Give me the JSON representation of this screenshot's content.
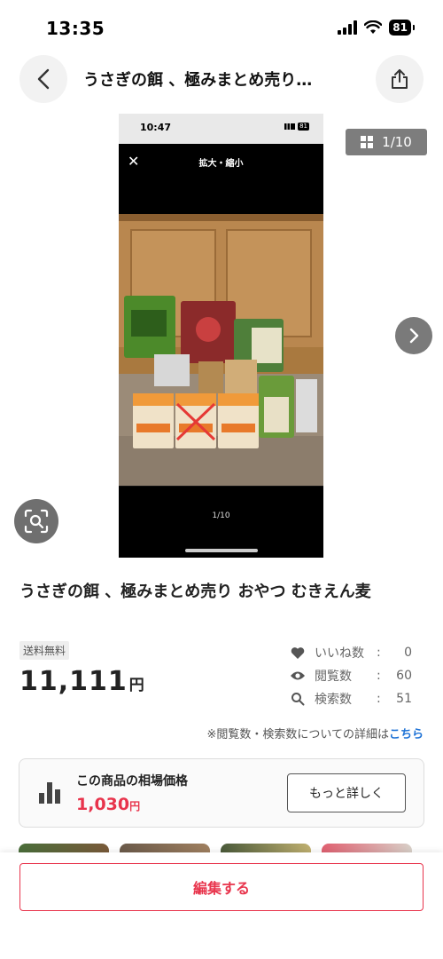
{
  "status_bar": {
    "time": "13:35",
    "battery": "81"
  },
  "nav": {
    "title": "うさぎの餌 、極みまとめ売り…"
  },
  "photo": {
    "inner_time": "10:47",
    "inner_battery": "81",
    "inner_title": "拡大・縮小",
    "inner_counter": "1/10"
  },
  "counter": {
    "label": "1/10"
  },
  "product": {
    "title": "うさぎの餌 、極みまとめ売り おやつ むきえん麦",
    "shipping": "送料無料",
    "price": "11,111",
    "currency": "円"
  },
  "stats": [
    {
      "icon": "heart-icon",
      "label": "いいね数",
      "colon": ":",
      "value": "0"
    },
    {
      "icon": "eye-icon",
      "label": "閲覧数",
      "colon": ":",
      "value": "60"
    },
    {
      "icon": "search-icon",
      "label": "検索数",
      "colon": ":",
      "value": "51"
    }
  ],
  "note": {
    "text": "※閲覧数・検索数についての詳細は",
    "link": "こちら"
  },
  "market": {
    "label": "この商品の相場価格",
    "price": "1,030",
    "currency": "円",
    "button": "もっと詳しく"
  },
  "bottom": {
    "edit_button": "編集する"
  },
  "colors": {
    "accent": "#e8344c",
    "link": "#1f73d6"
  }
}
